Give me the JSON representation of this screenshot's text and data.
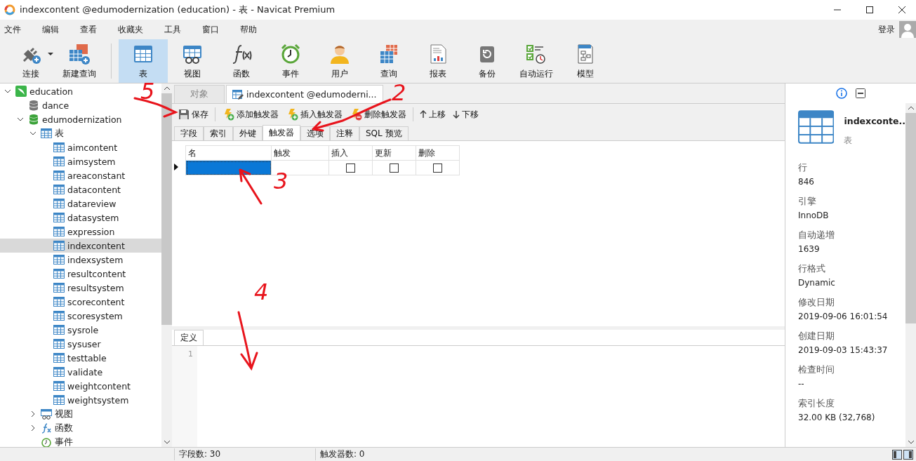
{
  "window": {
    "title": "indexcontent @edumodernization (education) - 表 - Navicat Premium"
  },
  "menu": [
    "文件",
    "编辑",
    "查看",
    "收藏夹",
    "工具",
    "窗口",
    "帮助"
  ],
  "account": {
    "label": "登录"
  },
  "toolbar": [
    {
      "label": "连接",
      "kind": "connect",
      "dropdown": true,
      "selected": false
    },
    {
      "label": "新建查询",
      "kind": "new-query",
      "dropdown": false,
      "selected": false
    },
    {
      "label": "表",
      "kind": "table",
      "dropdown": false,
      "selected": true
    },
    {
      "label": "视图",
      "kind": "view",
      "dropdown": false,
      "selected": false
    },
    {
      "label": "函数",
      "kind": "function",
      "dropdown": false,
      "selected": false
    },
    {
      "label": "事件",
      "kind": "event",
      "dropdown": false,
      "selected": false
    },
    {
      "label": "用户",
      "kind": "user",
      "dropdown": false,
      "selected": false
    },
    {
      "label": "查询",
      "kind": "query",
      "dropdown": false,
      "selected": false
    },
    {
      "label": "报表",
      "kind": "report",
      "dropdown": false,
      "selected": false
    },
    {
      "label": "备份",
      "kind": "backup",
      "dropdown": false,
      "selected": false
    },
    {
      "label": "自动运行",
      "kind": "schedule",
      "dropdown": false,
      "selected": false
    },
    {
      "label": "模型",
      "kind": "model",
      "dropdown": false,
      "selected": false
    }
  ],
  "tree": [
    {
      "label": "education",
      "kind": "connection",
      "expanded": true,
      "selected": false,
      "children": [
        {
          "label": "dance",
          "kind": "database",
          "selected": false
        },
        {
          "label": "edumodernization",
          "kind": "database-open",
          "expanded": true,
          "selected": false,
          "children": [
            {
              "label": "表",
              "kind": "tables",
              "expanded": true,
              "selected": false,
              "children": [
                {
                  "label": "aimcontent",
                  "kind": "table",
                  "selected": false
                },
                {
                  "label": "aimsystem",
                  "kind": "table",
                  "selected": false
                },
                {
                  "label": "areaconstant",
                  "kind": "table",
                  "selected": false
                },
                {
                  "label": "datacontent",
                  "kind": "table",
                  "selected": false
                },
                {
                  "label": "datareview",
                  "kind": "table",
                  "selected": false
                },
                {
                  "label": "datasystem",
                  "kind": "table",
                  "selected": false
                },
                {
                  "label": "expression",
                  "kind": "table",
                  "selected": false
                },
                {
                  "label": "indexcontent",
                  "kind": "table",
                  "selected": true
                },
                {
                  "label": "indexsystem",
                  "kind": "table",
                  "selected": false
                },
                {
                  "label": "resultcontent",
                  "kind": "table",
                  "selected": false
                },
                {
                  "label": "resultsystem",
                  "kind": "table",
                  "selected": false
                },
                {
                  "label": "scorecontent",
                  "kind": "table",
                  "selected": false
                },
                {
                  "label": "scoresystem",
                  "kind": "table",
                  "selected": false
                },
                {
                  "label": "sysrole",
                  "kind": "table",
                  "selected": false
                },
                {
                  "label": "sysuser",
                  "kind": "table",
                  "selected": false
                },
                {
                  "label": "testtable",
                  "kind": "table",
                  "selected": false
                },
                {
                  "label": "validate",
                  "kind": "table",
                  "selected": false
                },
                {
                  "label": "weightcontent",
                  "kind": "table",
                  "selected": false
                },
                {
                  "label": "weightsystem",
                  "kind": "table",
                  "selected": false
                }
              ]
            },
            {
              "label": "视图",
              "kind": "views",
              "expanded": false,
              "selected": false
            },
            {
              "label": "函数",
              "kind": "functions",
              "expanded": false,
              "selected": false
            },
            {
              "label": "事件",
              "kind": "events",
              "selected": false
            }
          ]
        }
      ]
    }
  ],
  "doc_tabs": [
    {
      "label": "对象",
      "kind": "plain",
      "selected": false
    },
    {
      "label": "indexcontent @edumoderni...",
      "kind": "design",
      "selected": true
    }
  ],
  "actions": [
    {
      "label": "保存",
      "kind": "save"
    },
    {
      "label": "添加触发器",
      "kind": "add"
    },
    {
      "label": "插入触发器",
      "kind": "insert"
    },
    {
      "label": "删除触发器",
      "kind": "delete"
    },
    {
      "label": "上移",
      "kind": "up"
    },
    {
      "label": "下移",
      "kind": "down"
    }
  ],
  "sub_tabs": [
    {
      "label": "字段",
      "selected": false
    },
    {
      "label": "索引",
      "selected": false
    },
    {
      "label": "外键",
      "selected": false
    },
    {
      "label": "触发器",
      "selected": true
    },
    {
      "label": "选项",
      "selected": false
    },
    {
      "label": "注释",
      "selected": false
    },
    {
      "label": "SQL 预览",
      "selected": false
    }
  ],
  "grid": {
    "columns": [
      "名",
      "触发",
      "插入",
      "更新",
      "删除"
    ],
    "rows": [
      {
        "selected": true,
        "insert": false,
        "update": false,
        "delete": false
      }
    ]
  },
  "definition": {
    "tab": "定义",
    "line_numbers": [
      "1"
    ]
  },
  "info": {
    "name": "indexconte..",
    "type": "表",
    "properties": [
      {
        "label": "行",
        "value": "846"
      },
      {
        "label": "引擎",
        "value": "InnoDB"
      },
      {
        "label": "自动递增",
        "value": "1639"
      },
      {
        "label": "行格式",
        "value": "Dynamic"
      },
      {
        "label": "修改日期",
        "value": "2019-09-06 16:01:54"
      },
      {
        "label": "创建日期",
        "value": "2019-09-03 15:43:37"
      },
      {
        "label": "检查时间",
        "value": "--"
      },
      {
        "label": "索引长度",
        "value": "32.00 KB (32,768)"
      }
    ]
  },
  "status_bar": [
    "字段数: 30",
    "触发器数: 0"
  ],
  "annotations": [
    {
      "label": "5"
    },
    {
      "label": "2"
    },
    {
      "label": "3"
    },
    {
      "label": "4"
    }
  ]
}
